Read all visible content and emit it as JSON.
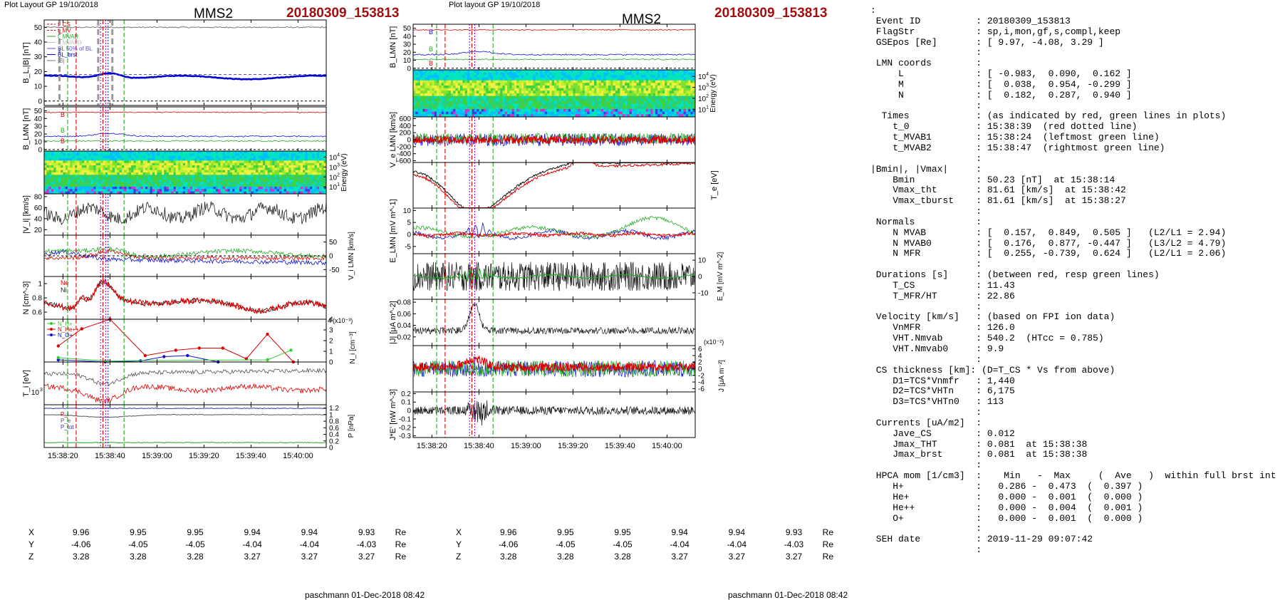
{
  "header": {
    "left_layout_label": "Plot Layout GP 19/10/2018",
    "right_layout_label": "Plot layout GP 19/10/2018",
    "spacecraft": "MMS2",
    "event_id": "20180309_153813",
    "footer": "paschmann 01-Dec-2018 08:42"
  },
  "colors": {
    "event_red": "#a01010",
    "bg_red": "#dd0000",
    "bg_green": "#22aa22",
    "bg_blue": "#1111cc",
    "marker_purple": "#9a00c8"
  },
  "time_axis": {
    "ticks": [
      "15:38:20",
      "15:38:40",
      "15:39:00",
      "15:39:20",
      "15:39:40",
      "15:40:00"
    ]
  },
  "left_coords": {
    "rows": [
      {
        "label": "X",
        "values": [
          "9.96",
          "9.95",
          "9.95",
          "9.94",
          "9.94",
          "9.93"
        ],
        "unit": "Re"
      },
      {
        "label": "Y",
        "values": [
          "-4.06",
          "-4.05",
          "-4.05",
          "-4.04",
          "-4.04",
          "-4.03"
        ],
        "unit": "Re"
      },
      {
        "label": "Z",
        "values": [
          "3.28",
          "3.28",
          "3.28",
          "3.27",
          "3.27",
          "3.27"
        ],
        "unit": "Re"
      }
    ]
  },
  "right_coords": {
    "rows": [
      {
        "label": "X",
        "values": [
          "9.96",
          "9.95",
          "9.95",
          "9.94",
          "9.94",
          "9.93"
        ],
        "unit": "Re"
      },
      {
        "label": "Y",
        "values": [
          "-4.06",
          "-4.05",
          "-4.05",
          "-4.04",
          "-4.04",
          "-4.03"
        ],
        "unit": "Re"
      },
      {
        "label": "Z",
        "values": [
          "3.28",
          "3.28",
          "3.28",
          "3.27",
          "3.27",
          "3.27"
        ],
        "unit": "Re"
      }
    ]
  },
  "chart_data": [
    {
      "id": "L1",
      "type": "line",
      "ylabel": "B_L,|B| [nT]",
      "yticks": [
        0,
        10,
        20,
        30,
        40,
        50
      ],
      "ylim": [
        -3,
        55
      ],
      "legend": [
        "t_CS",
        "t_MV",
        "t_MVAB",
        "t_MVAB0",
        "BL 50% of BL",
        "BL_brst",
        "|B|"
      ],
      "series": [
        {
          "name": "|B|",
          "color": "#777777",
          "mean": 50
        },
        {
          "name": "BL_brst",
          "color": "#0000cc",
          "mean": 16,
          "bump": 4
        }
      ]
    },
    {
      "id": "L2",
      "type": "line",
      "ylabel": "B_LMN [nT]",
      "yticks": [
        0,
        10,
        20,
        30,
        40,
        50
      ],
      "ylim": [
        -2,
        55
      ],
      "series": [
        {
          "name": "B_L",
          "color": "#dd0000",
          "mean": 48
        },
        {
          "name": "B_M",
          "color": "#22aa22",
          "mean": 11
        },
        {
          "name": "B_N",
          "color": "#1111cc",
          "mean": 18
        }
      ]
    },
    {
      "id": "L3",
      "type": "heatmap",
      "ylabel": "Energy (eV)",
      "yticks": [
        "10^4",
        "10^3",
        "10^2",
        "10^1"
      ]
    },
    {
      "id": "L4",
      "type": "line",
      "ylabel": "|V_i| [km/s]",
      "yticks": [
        20,
        40,
        60,
        80
      ],
      "ylim": [
        10,
        85
      ],
      "series": [
        {
          "name": "|V_i|",
          "color": "#222222",
          "mean": 50
        }
      ]
    },
    {
      "id": "L5",
      "type": "line",
      "ylabel": "V_i LMN [km/s]",
      "yticks": [
        50,
        0,
        -50
      ],
      "ylim": [
        -75,
        75
      ],
      "axis_side": "right",
      "series": [
        {
          "name": "V_L",
          "color": "#22aa22",
          "mean": 10
        },
        {
          "name": "V_M",
          "color": "#dd0000",
          "mean": -5
        },
        {
          "name": "V_N",
          "color": "#1111cc",
          "mean": 0
        }
      ]
    },
    {
      "id": "L6",
      "type": "line",
      "ylabel": "N [cm^-3]",
      "yticks": [
        0.6,
        0.8,
        1.0
      ],
      "ylim": [
        0.5,
        1.1
      ],
      "series": [
        {
          "name": "Ne",
          "color": "#dd0000",
          "mean": 0.68
        },
        {
          "name": "Ni",
          "color": "#222222",
          "mean": 0.68
        }
      ]
    },
    {
      "id": "L7",
      "type": "scatter",
      "ylabel": "N_i [cm^-3] (x10^-3)",
      "yticks": [
        0,
        1,
        2,
        3,
        4
      ],
      "ylim": [
        0,
        4
      ],
      "axis_side": "right",
      "legend": [
        "N_H+",
        "N_He++",
        "N_O+"
      ],
      "series": [
        {
          "name": "He++",
          "color": "#dd0000",
          "values": [
            1.5,
            3.1,
            4.0,
            0.6,
            1.1,
            1.3,
            1.3,
            0.3,
            2.6,
            0.0
          ]
        },
        {
          "name": "O+",
          "color": "#1111cc",
          "values": [
            0.2,
            0.0,
            0.1,
            0.5,
            0.6,
            0.0
          ]
        },
        {
          "name": "H+",
          "color": "#33cc33",
          "values": [
            0.4,
            0.1,
            0.2,
            1.1
          ]
        }
      ]
    },
    {
      "id": "L8",
      "type": "line",
      "ylabel": "T_i [eV]",
      "yticks": [
        "10^3"
      ],
      "series": [
        {
          "name": "T_par",
          "color": "#555555",
          "mean": 0.3
        },
        {
          "name": "T_perp",
          "color": "#dd0000",
          "mean": 0.65
        }
      ]
    },
    {
      "id": "L9",
      "type": "line",
      "ylabel": "P [nPa]",
      "yticks": [
        0.0,
        0.2,
        0.4,
        0.6,
        0.8,
        1.0,
        1.2
      ],
      "ylim": [
        0,
        1.3
      ],
      "axis_side": "right",
      "legend": [
        "P_i",
        "P_e",
        "P_tot"
      ],
      "series": [
        {
          "name": "P_tot",
          "color": "#3333aa",
          "mean": 1.18
        },
        {
          "name": "P_i",
          "color": "#555555",
          "mean": 1.0
        },
        {
          "name": "P_e",
          "color": "#22aa22",
          "mean": 0.15
        }
      ]
    },
    {
      "id": "R1",
      "type": "line",
      "ylabel": "B_LMN [nT]",
      "yticks": [
        0,
        10,
        20,
        30,
        40,
        50
      ],
      "ylim": [
        -2,
        55
      ],
      "series": [
        {
          "name": "B_L",
          "color": "#dd0000",
          "mean": 48
        },
        {
          "name": "B_M",
          "color": "#22aa22",
          "mean": 11
        },
        {
          "name": "B_N",
          "color": "#1111cc",
          "mean": 18
        }
      ]
    },
    {
      "id": "R2",
      "type": "heatmap",
      "ylabel": "Energy (eV)",
      "yticks": [
        "10^4",
        "10^3",
        "10^2",
        "10^1"
      ]
    },
    {
      "id": "R3",
      "type": "line",
      "ylabel": "V_e LMN [km/s]",
      "yticks": [
        600,
        400,
        200,
        0,
        -200,
        -400,
        -600
      ],
      "ylim": [
        -650,
        650
      ],
      "series": [
        {
          "name": "V_L",
          "color": "#1111cc",
          "mean": 0
        },
        {
          "name": "V_M",
          "color": "#22aa22",
          "mean": 0
        },
        {
          "name": "V_N",
          "color": "#dd0000",
          "mean": 0
        }
      ]
    },
    {
      "id": "R4",
      "type": "line",
      "ylabel": "T_e [eV]",
      "axis_side": "right",
      "series": [
        {
          "name": "T_par",
          "color": "#111111",
          "mean": 0.4
        },
        {
          "name": "T_perp",
          "color": "#dd0000",
          "mean": 0.45
        }
      ]
    },
    {
      "id": "R5",
      "type": "line",
      "ylabel": "E_LMN [mV m^-1]",
      "yticks": [
        10,
        5,
        0,
        -5
      ],
      "ylim": [
        -8,
        11
      ],
      "series": [
        {
          "name": "E_L",
          "color": "#1111cc",
          "mean": 0
        },
        {
          "name": "E_M",
          "color": "#22aa22",
          "mean": 1
        },
        {
          "name": "E_N",
          "color": "#dd0000",
          "mean": 0
        }
      ]
    },
    {
      "id": "R6",
      "type": "line",
      "ylabel": "E_M [mV m^-2]",
      "yticks": [
        10,
        0,
        -10
      ],
      "ylim": [
        -14,
        14
      ],
      "axis_side": "right",
      "series": [
        {
          "name": "E_M",
          "color": "#111111",
          "mean": 0
        },
        {
          "name": "E_M smooth",
          "color": "#22aa22",
          "mean": 0
        }
      ]
    },
    {
      "id": "R7",
      "type": "line",
      "ylabel": "|J| [μA m^-2]",
      "yticks": [
        0.02,
        0.04,
        0.06,
        0.08
      ],
      "ylim": [
        0.005,
        0.085
      ],
      "series": [
        {
          "name": "|J|",
          "color": "#111111",
          "mean": 0.025
        }
      ]
    },
    {
      "id": "R8",
      "type": "line",
      "ylabel": "J [μA m^-2] (x10^-2)",
      "yticks": [
        6,
        4,
        2,
        0,
        -2,
        -4,
        -6
      ],
      "ylim": [
        -7,
        7
      ],
      "axis_side": "right",
      "series": [
        {
          "name": "J_L",
          "color": "#1111cc",
          "mean": 0
        },
        {
          "name": "J_M",
          "color": "#22aa22",
          "mean": 0
        },
        {
          "name": "J_N",
          "color": "#dd0000",
          "mean": 0
        }
      ]
    },
    {
      "id": "R9",
      "type": "line",
      "ylabel": "J*E' [nW m^-3]",
      "yticks": [
        0.2,
        0.1,
        0.0,
        -0.1,
        -0.2,
        -0.3
      ],
      "ylim": [
        -0.32,
        0.22
      ],
      "series": [
        {
          "name": "J*E'",
          "color": "#111111",
          "mean": 0
        }
      ]
    }
  ],
  "info_lines": [
    ":",
    " Event ID          : 20180309_153813",
    " FlagStr           : sp,i,mon,gf,s,compl,keep",
    " GSEpos [Re]       : [ 9.97, -4.08, 3.29 ]",
    "                   :",
    " LMN coords        :",
    "     L             : [ -0.983,  0.090,  0.162 ]",
    "     M             : [  0.038,  0.954, -0.299 ]",
    "     N             : [  0.182,  0.287,  0.940 ]",
    "                   :",
    "  Times            : (as indicated by red, green lines in plots)",
    "    t_0            : 15:38:39  (red dotted line)",
    "    t_MVAB1        : 15:38:24  (leftmost green line)",
    "    t_MVAB2        : 15:38:47  (rightmost green line)",
    "                   :",
    "|Bmin|, |Vmax|     :",
    "    Bmin           : 50.23 [nT]  at 15:38:14",
    "    Vmax_tht       : 81.61 [km/s]  at 15:38:42",
    "    Vmax_tburst    : 81.61 [km/s]  at 15:38:27",
    "                   :",
    " Normals           :",
    "    N MVAB         : [  0.157,  0.849,  0.505 ]   (L2/L1 = 2.94)",
    "    N MVAB0        : [  0.176,  0.877, -0.447 ]   (L3/L2 = 4.79)",
    "    N MFR          : [  0.255, -0.739,  0.624 ]   (L2/L1 = 2.06)",
    "                   :",
    " Durations [s]     : (between red, resp green lines)",
    "    T_CS           : 11.43",
    "    T_MFR/HT       : 22.86",
    "                   :",
    " Velocity [km/s]   : (based on FPI ion data)",
    "    VnMFR          : 126.0",
    "    VHT.Nmvab      : 540.2  (HTcc = 0.785)",
    "    VHT.Nmvab0     : 9.9",
    "                   :",
    " CS thickness [km]: (D=T_CS * Vs from above)",
    "    D1=TCS*Vnmfr   : 1,440",
    "    D2=TCS*VHTn    : 6,175",
    "    D3=TCS*VHTn0   : 113",
    "                   :",
    " Currents [uA/m2]  :",
    "    Jave_CS        : 0.012",
    "    Jmax_THT       : 0.081  at 15:38:38",
    "    Jmax_brst      : 0.081  at 15:38:38",
    "                   :",
    " HPCA mom [1/cm3]  :    Min   -  Max     (  Ave   )  within full brst int",
    "    H+             :   0.286 -  0.473  (  0.397 )",
    "    He+            :   0.000 -  0.001  (  0.000 )",
    "    He++           :   0.000 -  0.004  (  0.001 )",
    "    O+             :   0.000 -  0.001  (  0.000 )",
    "                   :",
    " SEH date          : 2019-11-29 09:07:42",
    "                   :"
  ]
}
